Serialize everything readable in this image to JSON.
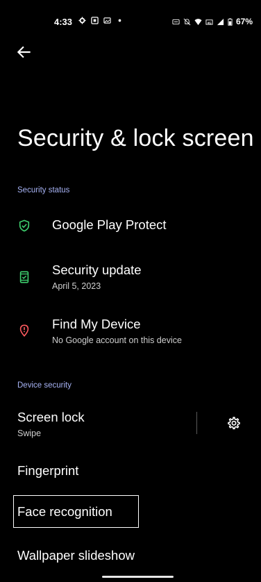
{
  "status_bar": {
    "time": "4:33",
    "battery": "67%"
  },
  "page": {
    "title": "Security & lock screen"
  },
  "sections": {
    "security_status": {
      "header": "Security status",
      "items": [
        {
          "title": "Google Play Protect",
          "subtitle": "",
          "icon": "shield-check-icon",
          "color": "#3ecf6e"
        },
        {
          "title": "Security update",
          "subtitle": "April 5, 2023",
          "icon": "phone-check-icon",
          "color": "#3ecf6e"
        },
        {
          "title": "Find My Device",
          "subtitle": "No Google account on this device",
          "icon": "location-alert-icon",
          "color": "#ff5a5f"
        }
      ]
    },
    "device_security": {
      "header": "Device security",
      "items": [
        {
          "title": "Screen lock",
          "subtitle": "Swipe"
        },
        {
          "title": "Fingerprint",
          "subtitle": ""
        },
        {
          "title": "Face recognition",
          "subtitle": ""
        },
        {
          "title": "Wallpaper slideshow",
          "subtitle": ""
        }
      ]
    }
  },
  "colors": {
    "background": "#000000",
    "accent": "#a7b3f5",
    "ok": "#3ecf6e",
    "alert": "#ff5a5f"
  }
}
